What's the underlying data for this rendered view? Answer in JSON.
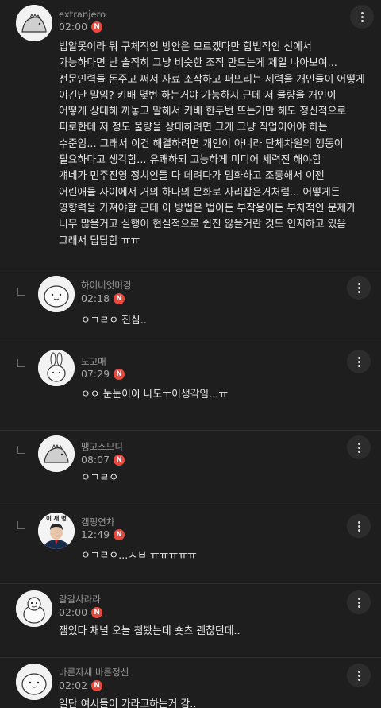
{
  "comments": [
    {
      "author": "extranjero",
      "time": "02:00",
      "badge": "N",
      "avatar_icon": "dino-avatar",
      "reply": false,
      "body": "법알못이라 뭐 구체적인 방안은 모르겠다만 합법적인 선에서\n가능하다면 난 솔직히 그냥 비슷한 조직 만드는게 제일 나아보여...\n전문인력들 돈주고 써서 자료 조작하고 퍼뜨리는 세력을 개인들이 어떻게\n이긴단 말임? 키배 몇번 하는거야 가능하지 근데 저 물량을 개인이\n어떻게 상대해 까놓고 말해서 키배 한두번 뜨는거만 해도 정신적으로\n피로한데 저 정도 물량을 상대하려면 그게 그냥 직업이어야 하는\n수준임... 그래서 이건 해결하려면 개인이 아니라 단체차원의 행동이\n필요하다고 생각함... 유쾌하되 고능하게 미디어 세력전 해야함\n걔네가 민주진영 정치인들 다 데려다가 밈화하고 조롱해서 이젠\n어린애들 사이에서 거의 하나의 문화로 자리잡은거처럼... 어떻게든\n영향력을 가져야함 근데 이 방법은 법이든 부작용이든 부차적인 문제가\n너무 많을거고 실행이 현실적으로 쉽진 않을거란 것도 인지하고 있음\n그래서 답답함 ㅠㅠ"
    },
    {
      "author": "하이비엇머겅",
      "time": "02:18",
      "badge": "N",
      "avatar_icon": "blob-avatar",
      "reply": true,
      "body": "ㅇㄱㄹㅇ 진심.."
    },
    {
      "author": "도고매",
      "time": "07:29",
      "badge": "N",
      "avatar_icon": "rabbit-avatar",
      "reply": true,
      "body": "ㅇㅇ 눈눈이이 나도ㅜ이생각임...ㅠ"
    },
    {
      "author": "맹고스므디",
      "time": "08:07",
      "badge": "N",
      "avatar_icon": "dino-avatar",
      "reply": true,
      "body": "ㅇㄱㄹㅇ"
    },
    {
      "author": "캠핑연차",
      "time": "12:49",
      "badge": "N",
      "avatar_icon": "portrait-avatar",
      "avatar_caption": "이 재 명",
      "reply": true,
      "body": "ㅇㄱㄹㅇ...ㅅㅂ ㅠㅠㅠㅠㅠ"
    },
    {
      "author": "갈갈사라라",
      "time": "02:00",
      "badge": "N",
      "avatar_icon": "duck-avatar",
      "reply": false,
      "body": "잼있다 채널 오늘 첨봤는데 숏츠 괜찮던데.."
    },
    {
      "author": "바른자세 바른정신",
      "time": "02:02",
      "badge": "N",
      "avatar_icon": "blob-avatar",
      "reply": false,
      "body": "일단 여시들이 가라고하는거 감.."
    }
  ]
}
